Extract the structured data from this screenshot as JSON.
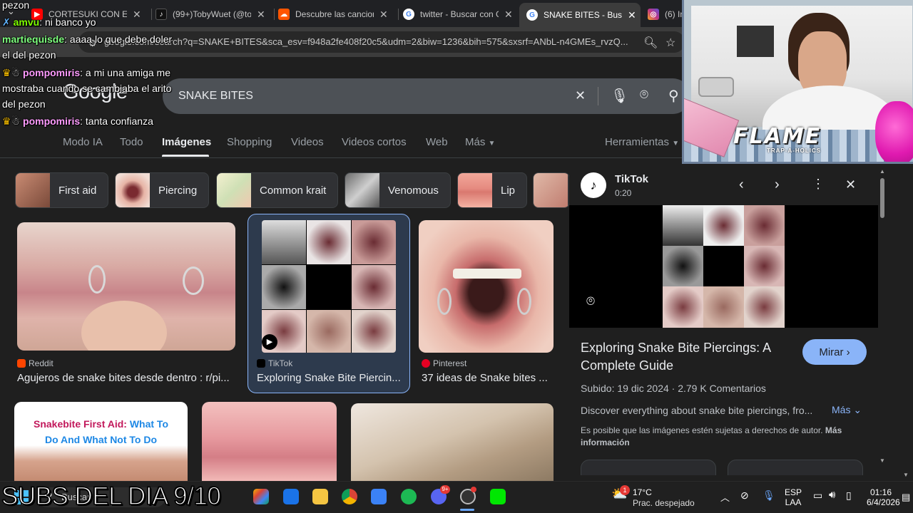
{
  "browser": {
    "tabs": [
      {
        "label": "CORTESUKI CON EL C",
        "favicon": "youtube-icon",
        "color": "#ff0000"
      },
      {
        "label": "(99+)TobyWuet (@to",
        "favicon": "tiktok-icon",
        "color": "#111111"
      },
      {
        "label": "Descubre las cancione",
        "favicon": "soundcloud-icon",
        "color": "#ff5500"
      },
      {
        "label": "twitter - Buscar con G",
        "favicon": "google-icon",
        "color": "#4285f4"
      },
      {
        "label": "SNAKE BITES - Busca",
        "favicon": "google-icon",
        "color": "#4285f4",
        "active": true
      },
      {
        "label": "(6) In",
        "favicon": "instagram-icon",
        "color": "#c13584"
      }
    ],
    "url": "google.com/search?q=SNAKE+BITES&sca_esv=f948a2fe408f20c5&udm=2&biw=1236&bih=575&sxsrf=ANbL-n4GMEs_rvzQ..."
  },
  "google": {
    "logo": "Google",
    "query": "SNAKE BITES",
    "nav": [
      "Modo IA",
      "Todo",
      "Imágenes",
      "Shopping",
      "Videos",
      "Videos cortos",
      "Web",
      "Más"
    ],
    "tools": "Herramientas",
    "chips": [
      "First aid",
      "Piercing",
      "Common krait",
      "Venomous",
      "Lip"
    ],
    "results": [
      {
        "source": "Reddit",
        "title": "Agujeros de snake bites desde dentro : r/pi..."
      },
      {
        "source": "TikTok",
        "title": "Exploring Snake Bite Piercin..."
      },
      {
        "source": "Pinterest",
        "title": "37 ideas de Snake bites ..."
      }
    ],
    "firstaid_text": "Snakebite First Aid: What To Do And What Not To Do",
    "firstaid_a": "Snakebite First Aid: ",
    "firstaid_b": "What To",
    "firstaid_c": "Do And What Not To Do"
  },
  "panel": {
    "source": "TikTok",
    "duration": "0:20",
    "title": "Exploring Snake Bite Piercings: A Complete Guide",
    "watch": "Mirar",
    "meta": "Subido: 19 dic 2024 · 2.79 K Comentarios",
    "desc": "Discover everything about snake bite piercings, fro...",
    "more": "Más",
    "copyright": "Es posible que las imágenes estén sujetas a derechos de autor.",
    "copyright_link": "Más información"
  },
  "chat": [
    {
      "user": "",
      "text": "pezon"
    },
    {
      "user": "amvu",
      "text": ": ni banco yo",
      "color": "#7fff00"
    },
    {
      "user": "martiequisde",
      "text": ": aaaa lo que debe doler",
      "color": "#7fff7f"
    },
    {
      "user": "",
      "text": "el del pezon"
    },
    {
      "user": "pompomiris",
      "text": ": a mi una amiga me",
      "color": "#ff9cff"
    },
    {
      "user": "",
      "text": "mostraba cuando se cambiaba el arito"
    },
    {
      "user": "",
      "text": "del pezon"
    },
    {
      "user": "pompomiris",
      "text": ": tanta confianza",
      "color": "#ff9cff"
    }
  ],
  "overlay": {
    "flame": "FLAME",
    "flame_sub": "TRAP-A-HOLICS",
    "subs": "SUBS DEL DIA 9/10"
  },
  "taskbar": {
    "search": "Buscar",
    "weather_temp": "17°C",
    "weather_desc": "Prac. despejado",
    "lang1": "ESP",
    "lang2": "LAA",
    "time": "01:16",
    "date": "6/4/2026",
    "weather_badge": "1",
    "discord_badge": "9+"
  }
}
